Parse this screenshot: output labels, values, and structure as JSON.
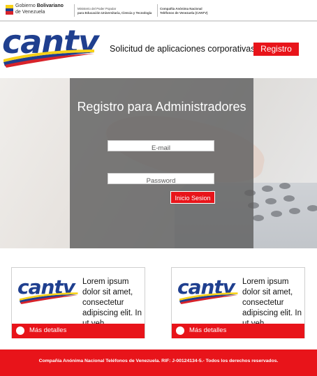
{
  "gov": {
    "line1_regular": "Gobierno ",
    "line1_bold": "Bolivariano",
    "line2": "de Venezuela",
    "ministry_line1": "Ministerio del Poder Popular",
    "ministry_line2": "para Educación Universitaria, Ciencia y Tecnología",
    "company_line1": "Compañía Anónima Nacional",
    "company_line2": "Teléfonos de Venezuela (CANTV)",
    "flag_colors": [
      "#f7d117",
      "#1f3f8f",
      "#d8232a"
    ]
  },
  "brand": {
    "logo_text": "cantv",
    "logo_color": "#1f3f8f",
    "accent": "#e8141a"
  },
  "header": {
    "title": "Solicitud de aplicaciones corporativas",
    "register_label": "Registro"
  },
  "login": {
    "title": "Registro para Administradores",
    "email_placeholder": "E-mail",
    "password_placeholder": "Password",
    "submit_label": "Inicio Sesion"
  },
  "cards": [
    {
      "text": "Lorem ipsum dolor sit amet, consectetur adipiscing elit. In ut veh",
      "more_label": "Más detalles"
    },
    {
      "text": "Lorem ipsum dolor sit amet, consectetur adipiscing elit. In ut veh",
      "more_label": "Más detalles"
    }
  ],
  "footer": {
    "text": "Compañía Anónima Nacional Teléfonos de Venezuela. RIF: J-00124134-5.- Todos los derechos reservados."
  }
}
